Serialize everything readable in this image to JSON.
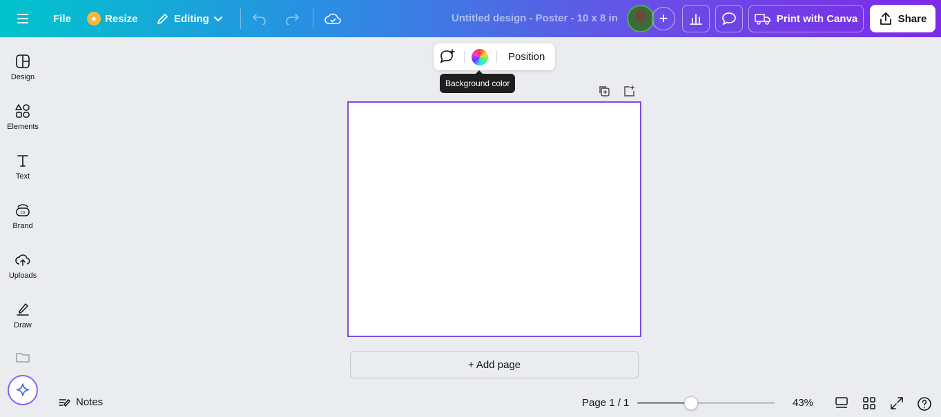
{
  "header": {
    "file_label": "File",
    "resize_label": "Resize",
    "editing_label": "Editing",
    "doc_title": "Untitled design - Poster - 10 x 8 in",
    "print_label": "Print with Canva",
    "share_label": "Share"
  },
  "sidebar": {
    "items": [
      {
        "label": "Design",
        "icon": "design-icon"
      },
      {
        "label": "Elements",
        "icon": "elements-icon"
      },
      {
        "label": "Text",
        "icon": "text-icon"
      },
      {
        "label": "Brand",
        "icon": "brand-icon"
      },
      {
        "label": "Uploads",
        "icon": "uploads-icon"
      },
      {
        "label": "Draw",
        "icon": "draw-icon"
      }
    ]
  },
  "canvas": {
    "position_label": "Position",
    "tooltip": "Background color",
    "add_page_label": "+ Add page"
  },
  "footer": {
    "notes_label": "Notes",
    "page_indicator": "Page 1 / 1",
    "zoom": "43%"
  },
  "colors": {
    "accent": "#7d4cdb",
    "header_start": "#00c4cc",
    "header_end": "#7d2ae8"
  }
}
